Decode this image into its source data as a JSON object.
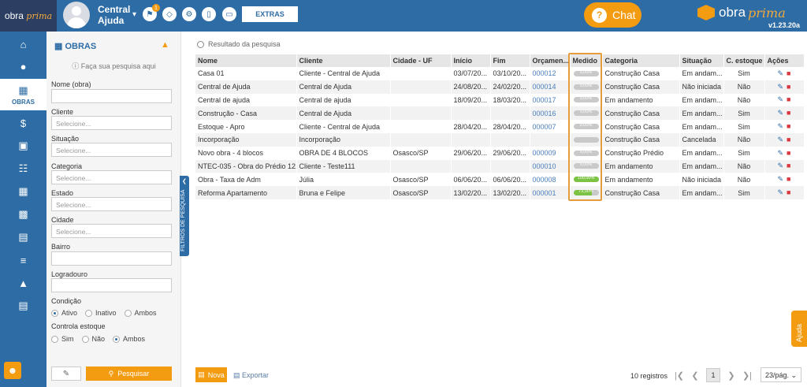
{
  "header": {
    "logo_main": "obra",
    "logo_accent": "prima",
    "user_name_line1": "Central",
    "user_name_line2": "Ajuda",
    "notification_count": "1",
    "extras_label": "EXTRAS",
    "chat_label": "Chat",
    "brand_main": "obra",
    "brand_accent": "prima",
    "version": "v1.23.20a"
  },
  "nav": {
    "active_label": "OBRAS"
  },
  "filters": {
    "title": "OBRAS",
    "hint": "Faça sua pesquisa aqui",
    "nome_label": "Nome (obra)",
    "cliente_label": "Cliente",
    "cliente_placeholder": "Selecione...",
    "situacao_label": "Situação",
    "situacao_placeholder": "Selecione...",
    "categoria_label": "Categoria",
    "categoria_placeholder": "Selecione...",
    "estado_label": "Estado",
    "estado_placeholder": "Selecione...",
    "cidade_label": "Cidade",
    "cidade_placeholder": "Selecione...",
    "bairro_label": "Bairro",
    "logradouro_label": "Logradouro",
    "condicao_label": "Condição",
    "condicao_options": [
      "Ativo",
      "Inativo",
      "Ambos"
    ],
    "estoque_label": "Controla estoque",
    "estoque_options": [
      "Sim",
      "Não",
      "Ambos"
    ],
    "search_label": "Pesquisar",
    "side_tab_label": "FILTROS DE PESQUISA"
  },
  "main": {
    "result_title": "Resultado da pesquisa",
    "columns": [
      "Nome",
      "Cliente",
      "Cidade - UF",
      "Início",
      "Fim",
      "Orçamen...",
      "Medido",
      "Categoria",
      "Situação",
      "C. estoque",
      "Ações"
    ],
    "rows": [
      {
        "nome": "Casa 01",
        "cliente": "Cliente - Central de Ajuda",
        "cidade": "",
        "inicio": "03/07/20...",
        "fim": "03/10/20...",
        "orcamento": "000012",
        "medido": 0,
        "medido_label": "0,00%",
        "categoria": "Construção Casa",
        "situacao": "Em andam...",
        "estoque": "Sim"
      },
      {
        "nome": "Central de Ajuda",
        "cliente": "Central de Ajuda",
        "cidade": "",
        "inicio": "24/08/20...",
        "fim": "24/02/20...",
        "orcamento": "000014",
        "medido": 0,
        "medido_label": "0,00%",
        "categoria": "Construção Casa",
        "situacao": "Não iniciada",
        "estoque": "Não"
      },
      {
        "nome": "Central de ajuda",
        "cliente": "Central de ajuda",
        "cidade": "",
        "inicio": "18/09/20...",
        "fim": "18/03/20...",
        "orcamento": "000017",
        "medido": 0,
        "medido_label": "0,00%",
        "categoria": "Em andamento",
        "situacao": "Em andam...",
        "estoque": "Não"
      },
      {
        "nome": "Construção - Casa",
        "cliente": "Central de Ajuda",
        "cidade": "",
        "inicio": "",
        "fim": "",
        "orcamento": "000016",
        "medido": 0,
        "medido_label": "0,00%",
        "categoria": "Construção Casa",
        "situacao": "Em andam...",
        "estoque": "Sim"
      },
      {
        "nome": "Estoque - Apro",
        "cliente": "Cliente - Central de Ajuda",
        "cidade": "",
        "inicio": "28/04/20...",
        "fim": "28/04/20...",
        "orcamento": "000007",
        "medido": 0,
        "medido_label": "0,00%",
        "categoria": "Construção Casa",
        "situacao": "Em andam...",
        "estoque": "Sim"
      },
      {
        "nome": "Incorporação",
        "cliente": "Incorporação",
        "cidade": "",
        "inicio": "",
        "fim": "",
        "orcamento": "",
        "medido": 0,
        "medido_label": "",
        "categoria": "Construção Casa",
        "situacao": "Cancelada",
        "estoque": "Não"
      },
      {
        "nome": "Novo obra - 4 blocos",
        "cliente": "OBRA DE 4 BLOCOS",
        "cidade": "Osasco/SP",
        "inicio": "29/06/20...",
        "fim": "29/06/20...",
        "orcamento": "000009",
        "medido": 0,
        "medido_label": "0,00%",
        "categoria": "Construção Prédio",
        "situacao": "Em andam...",
        "estoque": "Sim"
      },
      {
        "nome": "NTEC-035 - Obra do Prédio 12...",
        "cliente": "Cliente - Teste111",
        "cidade": "",
        "inicio": "",
        "fim": "",
        "orcamento": "000010",
        "medido": 0,
        "medido_label": "0,00%",
        "categoria": "Em andamento",
        "situacao": "Em andam...",
        "estoque": "Não"
      },
      {
        "nome": "Obra - Taxa de Adm",
        "cliente": "Júlia",
        "cidade": "Osasco/SP",
        "inicio": "06/06/20...",
        "fim": "06/06/20...",
        "orcamento": "000008",
        "medido": 100,
        "medido_label": "100,00%",
        "categoria": "Em andamento",
        "situacao": "Não iniciada",
        "estoque": "Não"
      },
      {
        "nome": "Reforma Apartamento",
        "cliente": "Bruna e Felipe",
        "cidade": "Osasco/SP",
        "inicio": "13/02/20...",
        "fim": "13/02/20...",
        "orcamento": "000001",
        "medido": 73,
        "medido_label": "73,00%",
        "categoria": "Construção Casa",
        "situacao": "Em andam...",
        "estoque": "Sim"
      }
    ]
  },
  "footer": {
    "nova_label": "Nova",
    "export_label": "Exportar",
    "records_label": "10 registros",
    "current_page": "1",
    "per_page": "23/pág."
  },
  "help_tab_label": "Ajuda",
  "colors": {
    "primary": "#2d6ca5",
    "accent": "#f39c12",
    "progress": "#7cc243"
  }
}
